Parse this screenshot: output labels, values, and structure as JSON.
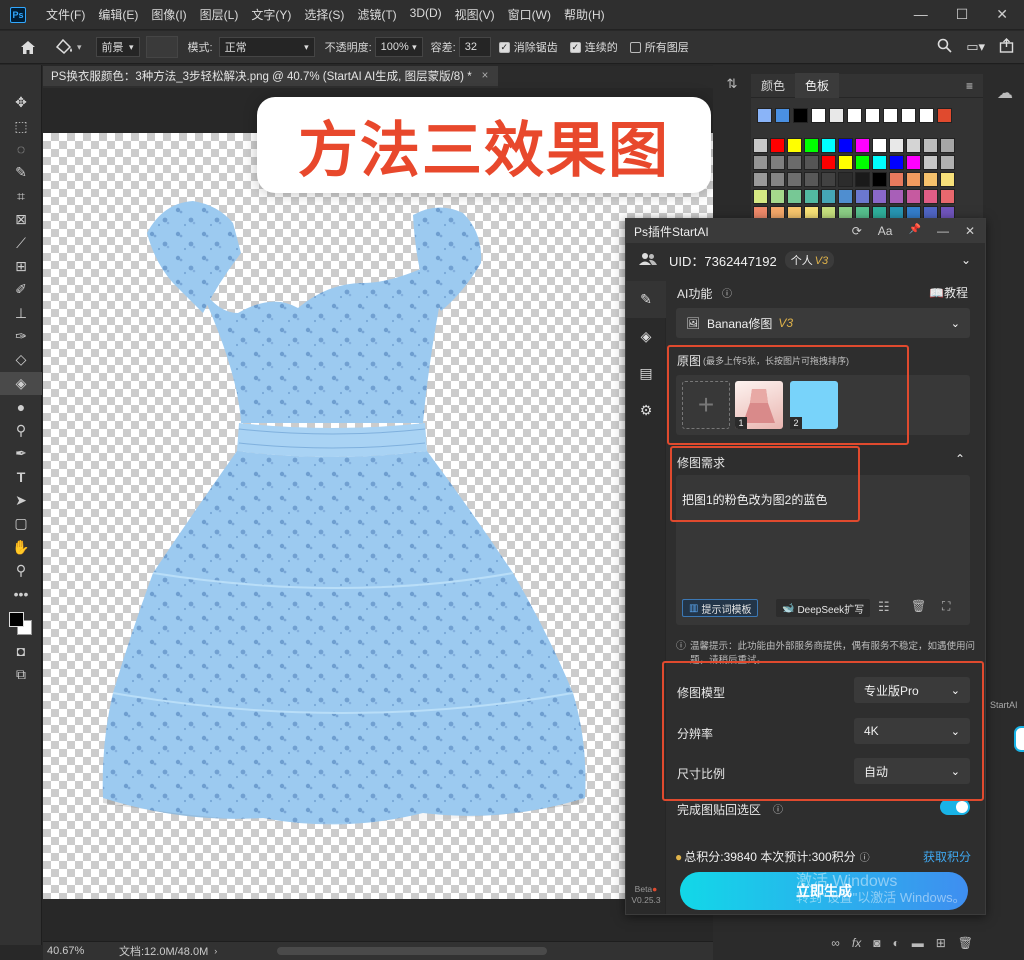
{
  "menubar": {
    "logo": "Ps",
    "items": [
      "文件(F)",
      "编辑(E)",
      "图像(I)",
      "图层(L)",
      "文字(Y)",
      "选择(S)",
      "滤镜(T)",
      "3D(D)",
      "视图(V)",
      "窗口(W)",
      "帮助(H)"
    ],
    "controls": {
      "minimize": "—",
      "maximize": "☐",
      "close": "✕"
    }
  },
  "options": {
    "home_icon": "home-icon",
    "fill_source": "前景",
    "mode_label": "模式:",
    "mode_value": "正常",
    "opacity_label": "不透明度:",
    "opacity_value": "100%",
    "tolerance_label": "容差:",
    "tolerance_value": "32",
    "checks": [
      {
        "label": "消除锯齿",
        "checked": true
      },
      {
        "label": "连续的",
        "checked": true
      },
      {
        "label": "所有图层",
        "checked": false
      }
    ]
  },
  "document": {
    "tab_title": "PS换衣服颜色：3种方法_3步轻松解决.png @ 40.7% (StartAI AI生成, 图层蒙版/8) *",
    "tab_close": "×",
    "banner_text": "方法三效果图",
    "zoom": "40.67%",
    "doc_info": "文档:12.0M/48.0M"
  },
  "swatches_panel": {
    "tabs": [
      "颜色",
      "色板"
    ],
    "active_tab": "色板",
    "row1": [
      "#8ab4f8",
      "#4a90e2",
      "#000000",
      "#ffffff",
      "#e8e8e8",
      "#ffffff",
      "#ffffff",
      "#ffffff",
      "#ffffff",
      "#ffffff",
      "#e04a2e"
    ],
    "grid": [
      "#c8c8c8",
      "#ff0000",
      "#ffff00",
      "#00ff00",
      "#00ffff",
      "#0000ff",
      "#ff00ff",
      "#ffffff",
      "#e8e8e8",
      "#d4d4d4",
      "#bdbdbd",
      "#a6a6a6",
      "#959595",
      "#7f7f7f",
      "#6b6b6b",
      "#555555",
      "#ff0000",
      "#ffff00",
      "#00ff00",
      "#00ffff",
      "#0000ff",
      "#ff00ff",
      "#c8c8c8",
      "#b0b0b0",
      "#9a9a9a",
      "#848484",
      "#6e6e6e",
      "#585858",
      "#424242",
      "#2c2c2c",
      "#1a1a1a",
      "#000000",
      "#e87a5d",
      "#f29b5f",
      "#f5c16c",
      "#f7e07a",
      "#d6e883",
      "#a6d88c",
      "#77c895",
      "#52b9a1",
      "#45a6b6",
      "#4f8ed0",
      "#6b78cf",
      "#8a68c9",
      "#a85fb8",
      "#c65aa0",
      "#e05d86",
      "#e8686e",
      "#f08a6b",
      "#f5a86a",
      "#f8c66d",
      "#f9e277",
      "#c7e07e",
      "#8ccf86",
      "#56c08e",
      "#2fb09c",
      "#2796b3",
      "#347ecc",
      "#5066c6",
      "#7055bd"
    ]
  },
  "plugin": {
    "title": "Ps插件StartAI",
    "title_icons": [
      "refresh-icon",
      "font-size-icon",
      "pin-icon",
      "minimize-icon",
      "close-icon"
    ],
    "title_icon_glyphs": [
      "⟳",
      "Aa",
      "📌",
      "—",
      "✕"
    ],
    "uid": "UID：7362447192",
    "plan": "个人",
    "plan_version": "V3",
    "side_icons": [
      "edit-icon",
      "layers-icon",
      "notes-icon",
      "settings-icon"
    ],
    "beta": "Beta",
    "version": "V0.25.3",
    "ai_label": "AI功能",
    "tutorial": "教程",
    "feature": "Banana修图",
    "feature_version": "V3",
    "source_label": "原图",
    "source_hint": "(最多上传5张，长按图片可拖拽排序)",
    "thumbs": [
      "1",
      "2"
    ],
    "req_label": "修图需求",
    "req_text": "把图1的粉色改为图2的蓝色",
    "btn_template": "提示词模板",
    "btn_deepseek": "DeepSeek扩写",
    "notice": "温馨提示：此功能由外部服务商提供，偶有服务不稳定，如遇使用问题，请稍后重试。",
    "model_label": "修图模型",
    "model_value": "专业版Pro",
    "res_label": "分辨率",
    "res_value": "4K",
    "ratio_label": "尺寸比例",
    "ratio_value": "自动",
    "paste_label": "完成图贴回选区",
    "paste_on": true,
    "points": "总积分:39840 本次预计:300积分",
    "earn": "获取积分",
    "generate": "立即生成"
  },
  "watermark": {
    "line1": "激活 Windows",
    "line2": "转到\"设置\"以激活 Windows。"
  },
  "side_tab": "StartAI"
}
